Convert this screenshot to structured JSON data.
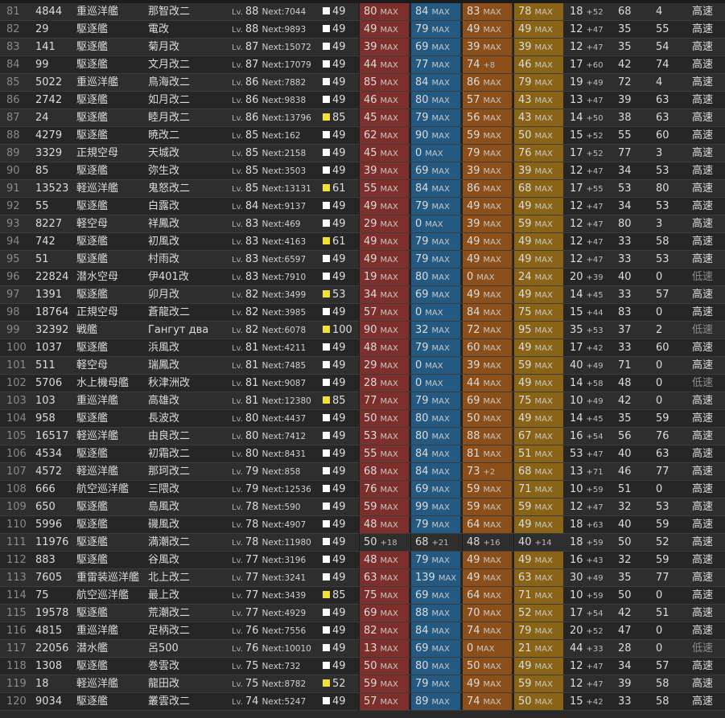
{
  "colors": {
    "firepower": "#7d2f2b",
    "torpedo": "#245a82",
    "aa": "#8c4f1a",
    "armor": "#8a6416",
    "cond_normal": "#ffffff",
    "cond_sparkle": "#f1e136"
  },
  "labels": {
    "lv": "Lv.",
    "max": "MAX"
  },
  "rows": [
    {
      "no": "81",
      "id": "4844",
      "type": "重巡洋艦",
      "name": "那智改二",
      "lv": "88",
      "next": "Next:7044",
      "cond": "49",
      "sparkle": false,
      "fp": "80",
      "fp_max": true,
      "tp": "84",
      "tp_max": true,
      "aa": "83",
      "aa_max": true,
      "ar": "78",
      "ar_max": true,
      "ev": "18",
      "ev_plus": "+52",
      "asw": "68",
      "los": "4",
      "speed": "高速"
    },
    {
      "no": "82",
      "id": "29",
      "type": "駆逐艦",
      "name": "電改",
      "lv": "88",
      "next": "Next:9893",
      "cond": "49",
      "sparkle": false,
      "fp": "49",
      "fp_max": true,
      "tp": "79",
      "tp_max": true,
      "aa": "49",
      "aa_max": true,
      "ar": "49",
      "ar_max": true,
      "ev": "12",
      "ev_plus": "+47",
      "asw": "35",
      "los": "55",
      "speed": "高速"
    },
    {
      "no": "83",
      "id": "141",
      "type": "駆逐艦",
      "name": "菊月改",
      "lv": "87",
      "next": "Next:15072",
      "cond": "49",
      "sparkle": false,
      "fp": "39",
      "fp_max": true,
      "tp": "69",
      "tp_max": true,
      "aa": "39",
      "aa_max": true,
      "ar": "39",
      "ar_max": true,
      "ev": "12",
      "ev_plus": "+47",
      "asw": "35",
      "los": "54",
      "speed": "高速"
    },
    {
      "no": "84",
      "id": "99",
      "type": "駆逐艦",
      "name": "文月改二",
      "lv": "87",
      "next": "Next:17079",
      "cond": "49",
      "sparkle": false,
      "fp": "44",
      "fp_max": true,
      "tp": "77",
      "tp_max": true,
      "aa": "74",
      "aa_max": false,
      "aa_plus": "+8",
      "ar": "46",
      "ar_max": true,
      "ev": "17",
      "ev_plus": "+60",
      "asw": "42",
      "los": "74",
      "speed": "高速"
    },
    {
      "no": "85",
      "id": "5022",
      "type": "重巡洋艦",
      "name": "鳥海改二",
      "lv": "86",
      "next": "Next:7882",
      "cond": "49",
      "sparkle": false,
      "fp": "85",
      "fp_max": true,
      "tp": "84",
      "tp_max": true,
      "aa": "86",
      "aa_max": true,
      "ar": "79",
      "ar_max": true,
      "ev": "19",
      "ev_plus": "+49",
      "asw": "72",
      "los": "4",
      "speed": "高速"
    },
    {
      "no": "86",
      "id": "2742",
      "type": "駆逐艦",
      "name": "如月改二",
      "lv": "86",
      "next": "Next:9838",
      "cond": "49",
      "sparkle": false,
      "fp": "46",
      "fp_max": true,
      "tp": "80",
      "tp_max": true,
      "aa": "57",
      "aa_max": true,
      "ar": "43",
      "ar_max": true,
      "ev": "13",
      "ev_plus": "+47",
      "asw": "39",
      "los": "63",
      "speed": "高速"
    },
    {
      "no": "87",
      "id": "24",
      "type": "駆逐艦",
      "name": "睦月改二",
      "lv": "86",
      "next": "Next:13796",
      "cond": "85",
      "sparkle": true,
      "fp": "45",
      "fp_max": true,
      "tp": "79",
      "tp_max": true,
      "aa": "56",
      "aa_max": true,
      "ar": "43",
      "ar_max": true,
      "ev": "14",
      "ev_plus": "+50",
      "asw": "38",
      "los": "63",
      "speed": "高速"
    },
    {
      "no": "88",
      "id": "4279",
      "type": "駆逐艦",
      "name": "暁改二",
      "lv": "85",
      "next": "Next:162",
      "cond": "49",
      "sparkle": false,
      "fp": "62",
      "fp_max": true,
      "tp": "90",
      "tp_max": true,
      "aa": "59",
      "aa_max": true,
      "ar": "50",
      "ar_max": true,
      "ev": "15",
      "ev_plus": "+52",
      "asw": "55",
      "los": "60",
      "speed": "高速"
    },
    {
      "no": "89",
      "id": "3329",
      "type": "正規空母",
      "name": "天城改",
      "lv": "85",
      "next": "Next:2158",
      "cond": "49",
      "sparkle": false,
      "fp": "45",
      "fp_max": true,
      "tp": "0",
      "tp_max": true,
      "aa": "79",
      "aa_max": true,
      "ar": "76",
      "ar_max": true,
      "ev": "17",
      "ev_plus": "+52",
      "asw": "77",
      "los": "3",
      "speed": "高速"
    },
    {
      "no": "90",
      "id": "85",
      "type": "駆逐艦",
      "name": "弥生改",
      "lv": "85",
      "next": "Next:3503",
      "cond": "49",
      "sparkle": false,
      "fp": "39",
      "fp_max": true,
      "tp": "69",
      "tp_max": true,
      "aa": "39",
      "aa_max": true,
      "ar": "39",
      "ar_max": true,
      "ev": "12",
      "ev_plus": "+47",
      "asw": "34",
      "los": "53",
      "speed": "高速"
    },
    {
      "no": "91",
      "id": "13523",
      "type": "軽巡洋艦",
      "name": "鬼怒改二",
      "lv": "85",
      "next": "Next:13131",
      "cond": "61",
      "sparkle": true,
      "fp": "55",
      "fp_max": true,
      "tp": "84",
      "tp_max": true,
      "aa": "86",
      "aa_max": true,
      "ar": "68",
      "ar_max": true,
      "ev": "17",
      "ev_plus": "+55",
      "asw": "53",
      "los": "80",
      "speed": "高速"
    },
    {
      "no": "92",
      "id": "55",
      "type": "駆逐艦",
      "name": "白露改",
      "lv": "84",
      "next": "Next:9137",
      "cond": "49",
      "sparkle": false,
      "fp": "49",
      "fp_max": true,
      "tp": "79",
      "tp_max": true,
      "aa": "49",
      "aa_max": true,
      "ar": "49",
      "ar_max": true,
      "ev": "12",
      "ev_plus": "+47",
      "asw": "34",
      "los": "53",
      "speed": "高速"
    },
    {
      "no": "93",
      "id": "8227",
      "type": "軽空母",
      "name": "祥鳳改",
      "lv": "83",
      "next": "Next:469",
      "cond": "49",
      "sparkle": false,
      "fp": "29",
      "fp_max": true,
      "tp": "0",
      "tp_max": true,
      "aa": "39",
      "aa_max": true,
      "ar": "59",
      "ar_max": true,
      "ev": "12",
      "ev_plus": "+47",
      "asw": "80",
      "los": "3",
      "speed": "高速"
    },
    {
      "no": "94",
      "id": "742",
      "type": "駆逐艦",
      "name": "初風改",
      "lv": "83",
      "next": "Next:4163",
      "cond": "61",
      "sparkle": true,
      "fp": "49",
      "fp_max": true,
      "tp": "79",
      "tp_max": true,
      "aa": "49",
      "aa_max": true,
      "ar": "49",
      "ar_max": true,
      "ev": "12",
      "ev_plus": "+47",
      "asw": "33",
      "los": "58",
      "speed": "高速"
    },
    {
      "no": "95",
      "id": "51",
      "type": "駆逐艦",
      "name": "村雨改",
      "lv": "83",
      "next": "Next:6597",
      "cond": "49",
      "sparkle": false,
      "fp": "49",
      "fp_max": true,
      "tp": "79",
      "tp_max": true,
      "aa": "49",
      "aa_max": true,
      "ar": "49",
      "ar_max": true,
      "ev": "12",
      "ev_plus": "+47",
      "asw": "33",
      "los": "53",
      "speed": "高速"
    },
    {
      "no": "96",
      "id": "22824",
      "type": "潜水空母",
      "name": "伊401改",
      "lv": "83",
      "next": "Next:7910",
      "cond": "49",
      "sparkle": false,
      "fp": "19",
      "fp_max": true,
      "tp": "80",
      "tp_max": true,
      "aa": "0",
      "aa_max": true,
      "ar": "24",
      "ar_max": true,
      "ev": "20",
      "ev_plus": "+39",
      "asw": "40",
      "los": "0",
      "speed": "低速"
    },
    {
      "no": "97",
      "id": "1391",
      "type": "駆逐艦",
      "name": "卯月改",
      "lv": "82",
      "next": "Next:3499",
      "cond": "53",
      "sparkle": true,
      "fp": "34",
      "fp_max": true,
      "tp": "69",
      "tp_max": true,
      "aa": "49",
      "aa_max": true,
      "ar": "49",
      "ar_max": true,
      "ev": "14",
      "ev_plus": "+45",
      "asw": "33",
      "los": "57",
      "speed": "高速"
    },
    {
      "no": "98",
      "id": "18764",
      "type": "正規空母",
      "name": "蒼龍改二",
      "lv": "82",
      "next": "Next:3985",
      "cond": "49",
      "sparkle": false,
      "fp": "57",
      "fp_max": true,
      "tp": "0",
      "tp_max": true,
      "aa": "84",
      "aa_max": true,
      "ar": "75",
      "ar_max": true,
      "ev": "15",
      "ev_plus": "+44",
      "asw": "83",
      "los": "0",
      "speed": "高速"
    },
    {
      "no": "99",
      "id": "32392",
      "type": "戦艦",
      "name": "Гангут два",
      "lv": "82",
      "next": "Next:6078",
      "cond": "100",
      "sparkle": true,
      "fp": "90",
      "fp_max": true,
      "tp": "32",
      "tp_max": true,
      "aa": "72",
      "aa_max": true,
      "ar": "95",
      "ar_max": true,
      "ev": "35",
      "ev_plus": "+53",
      "asw": "37",
      "los": "2",
      "speed": "低速"
    },
    {
      "no": "100",
      "id": "1037",
      "type": "駆逐艦",
      "name": "浜風改",
      "lv": "81",
      "next": "Next:4211",
      "cond": "49",
      "sparkle": false,
      "fp": "48",
      "fp_max": true,
      "tp": "79",
      "tp_max": true,
      "aa": "60",
      "aa_max": true,
      "ar": "49",
      "ar_max": true,
      "ev": "17",
      "ev_plus": "+42",
      "asw": "33",
      "los": "60",
      "speed": "高速"
    },
    {
      "no": "101",
      "id": "511",
      "type": "軽空母",
      "name": "瑞鳳改",
      "lv": "81",
      "next": "Next:7485",
      "cond": "49",
      "sparkle": false,
      "fp": "29",
      "fp_max": true,
      "tp": "0",
      "tp_max": true,
      "aa": "39",
      "aa_max": true,
      "ar": "59",
      "ar_max": true,
      "ev": "40",
      "ev_plus": "+49",
      "asw": "71",
      "los": "0",
      "speed": "高速"
    },
    {
      "no": "102",
      "id": "5706",
      "type": "水上機母艦",
      "name": "秋津洲改",
      "lv": "81",
      "next": "Next:9087",
      "cond": "49",
      "sparkle": false,
      "fp": "28",
      "fp_max": true,
      "tp": "0",
      "tp_max": true,
      "aa": "44",
      "aa_max": true,
      "ar": "49",
      "ar_max": true,
      "ev": "14",
      "ev_plus": "+58",
      "asw": "48",
      "los": "0",
      "speed": "低速"
    },
    {
      "no": "103",
      "id": "103",
      "type": "重巡洋艦",
      "name": "高雄改",
      "lv": "81",
      "next": "Next:12380",
      "cond": "85",
      "sparkle": true,
      "fp": "77",
      "fp_max": true,
      "tp": "79",
      "tp_max": true,
      "aa": "69",
      "aa_max": true,
      "ar": "75",
      "ar_max": true,
      "ev": "10",
      "ev_plus": "+49",
      "asw": "42",
      "los": "0",
      "speed": "高速"
    },
    {
      "no": "104",
      "id": "958",
      "type": "駆逐艦",
      "name": "長波改",
      "lv": "80",
      "next": "Next:4437",
      "cond": "49",
      "sparkle": false,
      "fp": "50",
      "fp_max": true,
      "tp": "80",
      "tp_max": true,
      "aa": "50",
      "aa_max": true,
      "ar": "49",
      "ar_max": true,
      "ev": "14",
      "ev_plus": "+45",
      "asw": "35",
      "los": "59",
      "speed": "高速"
    },
    {
      "no": "105",
      "id": "16517",
      "type": "軽巡洋艦",
      "name": "由良改二",
      "lv": "80",
      "next": "Next:7412",
      "cond": "49",
      "sparkle": false,
      "fp": "53",
      "fp_max": true,
      "tp": "80",
      "tp_max": true,
      "aa": "88",
      "aa_max": true,
      "ar": "67",
      "ar_max": true,
      "ev": "16",
      "ev_plus": "+54",
      "asw": "56",
      "los": "76",
      "speed": "高速"
    },
    {
      "no": "106",
      "id": "4534",
      "type": "駆逐艦",
      "name": "初霜改二",
      "lv": "80",
      "next": "Next:8431",
      "cond": "49",
      "sparkle": false,
      "fp": "55",
      "fp_max": true,
      "tp": "84",
      "tp_max": true,
      "aa": "81",
      "aa_max": true,
      "ar": "51",
      "ar_max": true,
      "ev": "53",
      "ev_plus": "+47",
      "asw": "40",
      "los": "63",
      "speed": "高速"
    },
    {
      "no": "107",
      "id": "4572",
      "type": "軽巡洋艦",
      "name": "那珂改二",
      "lv": "79",
      "next": "Next:858",
      "cond": "49",
      "sparkle": false,
      "fp": "68",
      "fp_max": true,
      "tp": "84",
      "tp_max": true,
      "aa": "73",
      "aa_max": false,
      "aa_plus": "+2",
      "ar": "68",
      "ar_max": true,
      "ev": "13",
      "ev_plus": "+71",
      "asw": "46",
      "los": "77",
      "speed": "高速"
    },
    {
      "no": "108",
      "id": "666",
      "type": "航空巡洋艦",
      "name": "三隈改",
      "lv": "79",
      "next": "Next:12536",
      "cond": "49",
      "sparkle": false,
      "fp": "76",
      "fp_max": true,
      "tp": "69",
      "tp_max": true,
      "aa": "59",
      "aa_max": true,
      "ar": "71",
      "ar_max": true,
      "ev": "10",
      "ev_plus": "+59",
      "asw": "51",
      "los": "0",
      "speed": "高速"
    },
    {
      "no": "109",
      "id": "650",
      "type": "駆逐艦",
      "name": "島風改",
      "lv": "78",
      "next": "Next:590",
      "cond": "49",
      "sparkle": false,
      "fp": "59",
      "fp_max": true,
      "tp": "99",
      "tp_max": true,
      "aa": "59",
      "aa_max": true,
      "ar": "59",
      "ar_max": true,
      "ev": "12",
      "ev_plus": "+47",
      "asw": "32",
      "los": "53",
      "speed": "高速"
    },
    {
      "no": "110",
      "id": "5996",
      "type": "駆逐艦",
      "name": "磯風改",
      "lv": "78",
      "next": "Next:4907",
      "cond": "49",
      "sparkle": false,
      "fp": "48",
      "fp_max": true,
      "tp": "79",
      "tp_max": true,
      "aa": "64",
      "aa_max": true,
      "ar": "49",
      "ar_max": true,
      "ev": "18",
      "ev_plus": "+63",
      "asw": "40",
      "los": "59",
      "speed": "高速"
    },
    {
      "no": "111",
      "id": "11976",
      "type": "駆逐艦",
      "name": "満潮改二",
      "lv": "78",
      "next": "Next:11980",
      "cond": "49",
      "sparkle": false,
      "plain_stats": true,
      "fp": "50",
      "fp_max": false,
      "fp_plus": "+18",
      "tp": "68",
      "tp_max": false,
      "tp_plus": "+21",
      "aa": "48",
      "aa_max": false,
      "aa_plus": "+16",
      "ar": "40",
      "ar_max": false,
      "ar_plus": "+14",
      "ev": "18",
      "ev_plus": "+59",
      "asw": "50",
      "los": "52",
      "speed": "高速"
    },
    {
      "no": "112",
      "id": "883",
      "type": "駆逐艦",
      "name": "谷風改",
      "lv": "77",
      "next": "Next:3196",
      "cond": "49",
      "sparkle": false,
      "fp": "48",
      "fp_max": true,
      "tp": "79",
      "tp_max": true,
      "aa": "49",
      "aa_max": true,
      "ar": "49",
      "ar_max": true,
      "ev": "16",
      "ev_plus": "+43",
      "asw": "32",
      "los": "59",
      "speed": "高速"
    },
    {
      "no": "113",
      "id": "7605",
      "type": "重雷装巡洋艦",
      "name": "北上改二",
      "lv": "77",
      "next": "Next:3241",
      "cond": "49",
      "sparkle": false,
      "fp": "63",
      "fp_max": true,
      "tp": "139",
      "tp_max": true,
      "aa": "49",
      "aa_max": true,
      "ar": "63",
      "ar_max": true,
      "ev": "30",
      "ev_plus": "+49",
      "asw": "35",
      "los": "77",
      "speed": "高速"
    },
    {
      "no": "114",
      "id": "75",
      "type": "航空巡洋艦",
      "name": "最上改",
      "lv": "77",
      "next": "Next:3439",
      "cond": "85",
      "sparkle": true,
      "fp": "75",
      "fp_max": true,
      "tp": "69",
      "tp_max": true,
      "aa": "64",
      "aa_max": true,
      "ar": "71",
      "ar_max": true,
      "ev": "10",
      "ev_plus": "+59",
      "asw": "50",
      "los": "0",
      "speed": "高速"
    },
    {
      "no": "115",
      "id": "19578",
      "type": "駆逐艦",
      "name": "荒潮改二",
      "lv": "77",
      "next": "Next:4929",
      "cond": "49",
      "sparkle": false,
      "fp": "69",
      "fp_max": true,
      "tp": "88",
      "tp_max": true,
      "aa": "70",
      "aa_max": true,
      "ar": "52",
      "ar_max": true,
      "ev": "17",
      "ev_plus": "+54",
      "asw": "42",
      "los": "51",
      "speed": "高速"
    },
    {
      "no": "116",
      "id": "4815",
      "type": "重巡洋艦",
      "name": "足柄改二",
      "lv": "76",
      "next": "Next:7556",
      "cond": "49",
      "sparkle": false,
      "fp": "82",
      "fp_max": true,
      "tp": "84",
      "tp_max": true,
      "aa": "74",
      "aa_max": true,
      "ar": "79",
      "ar_max": true,
      "ev": "20",
      "ev_plus": "+52",
      "asw": "47",
      "los": "0",
      "speed": "高速"
    },
    {
      "no": "117",
      "id": "22056",
      "type": "潜水艦",
      "name": "呂500",
      "lv": "76",
      "next": "Next:10010",
      "cond": "49",
      "sparkle": false,
      "fp": "13",
      "fp_max": true,
      "tp": "69",
      "tp_max": true,
      "aa": "0",
      "aa_max": true,
      "ar": "21",
      "ar_max": true,
      "ev": "44",
      "ev_plus": "+33",
      "asw": "28",
      "los": "0",
      "speed": "低速"
    },
    {
      "no": "118",
      "id": "1308",
      "type": "駆逐艦",
      "name": "巻雲改",
      "lv": "75",
      "next": "Next:732",
      "cond": "49",
      "sparkle": false,
      "fp": "50",
      "fp_max": true,
      "tp": "80",
      "tp_max": true,
      "aa": "50",
      "aa_max": true,
      "ar": "49",
      "ar_max": true,
      "ev": "12",
      "ev_plus": "+47",
      "asw": "34",
      "los": "57",
      "speed": "高速"
    },
    {
      "no": "119",
      "id": "18",
      "type": "軽巡洋艦",
      "name": "龍田改",
      "lv": "75",
      "next": "Next:8782",
      "cond": "52",
      "sparkle": true,
      "fp": "59",
      "fp_max": true,
      "tp": "79",
      "tp_max": true,
      "aa": "49",
      "aa_max": true,
      "ar": "59",
      "ar_max": true,
      "ev": "12",
      "ev_plus": "+47",
      "asw": "39",
      "los": "58",
      "speed": "高速"
    },
    {
      "no": "120",
      "id": "9034",
      "type": "駆逐艦",
      "name": "叢雲改二",
      "lv": "74",
      "next": "Next:5247",
      "cond": "49",
      "sparkle": false,
      "fp": "57",
      "fp_max": true,
      "tp": "89",
      "tp_max": true,
      "aa": "74",
      "aa_max": true,
      "ar": "50",
      "ar_max": true,
      "ev": "15",
      "ev_plus": "+42",
      "asw": "33",
      "los": "58",
      "speed": "高速"
    }
  ]
}
